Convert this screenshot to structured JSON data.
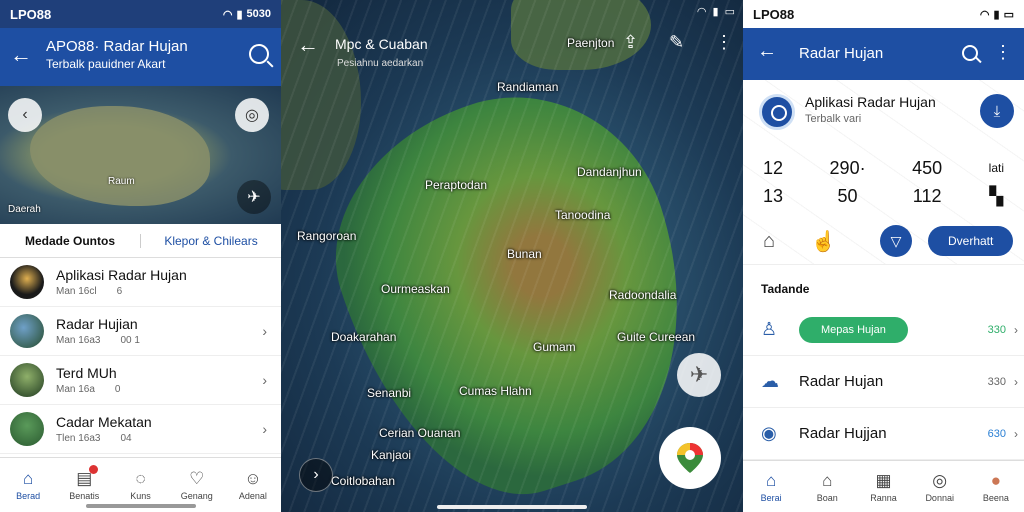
{
  "left": {
    "status_time": "LPO88",
    "status_battery": "5030",
    "title": "APO88· Radar Hujan",
    "subtitle": "Terbalk pauidner Akart",
    "map_labels": {
      "town": "Raum",
      "coast": "Daerah"
    },
    "tabs": [
      "Medade Ountos",
      "Klepor & Chilears"
    ],
    "rows": [
      {
        "name": "Aplikasi Radar Hujan",
        "meta1": "Man 16cl",
        "meta2": "6"
      },
      {
        "name": "Radar Hujian",
        "meta1": "Man 16a3",
        "meta2": "00 1"
      },
      {
        "name": "Terd MUh",
        "meta1": "Man 16a",
        "meta2": "0"
      },
      {
        "name": "Cadar Mekatan",
        "meta1": "Tlen 16a3",
        "meta2": "04"
      }
    ],
    "nav": [
      "Berad",
      "Benatis",
      "Kuns",
      "Genang",
      "Adenal"
    ]
  },
  "middle": {
    "title": "Mpc & Cuaban",
    "subtitle": "Pesiahnu aedarkan",
    "places": {
      "p1": "Paenjton",
      "p2": "Randiaman",
      "p3": "Peraptodan",
      "p4": "Dandanjhun",
      "p5": "Tanoodina",
      "p6": "Rangoroan",
      "p7": "Bunan",
      "p8": "Ourmeaskan",
      "p9": "Radoondalia",
      "p10": "Doakarahan",
      "p11": "Guite Cureean",
      "p12": "Gumam",
      "p13": "Senanbi",
      "p14": "Cumas Hlahn",
      "p15": "Cerian Ouanan",
      "p16": "Kanjaoi",
      "p17": "Coitlobahan"
    }
  },
  "right": {
    "status_time": "LPO88",
    "title": "Radar Hujan",
    "card_title": "Aplikasi Radar Hujan",
    "card_sub": "Terbalk vari",
    "stats": [
      {
        "top": "12",
        "bottom": "13"
      },
      {
        "top": "290·",
        "bottom": "50"
      },
      {
        "top": "450",
        "bottom": "112"
      },
      {
        "top": "lati",
        "bottom": ""
      }
    ],
    "action_button": "Dverhatt",
    "section": "Tadande",
    "rows": [
      {
        "label": "Mepas Hujan",
        "value": "330"
      },
      {
        "label": "Radar Hujan",
        "value": "330"
      },
      {
        "label": "Radar Hujjan",
        "value": "630"
      }
    ],
    "nav": [
      "Berai",
      "Boan",
      "Ranna",
      "Donnai",
      "Beena"
    ]
  },
  "colors": {
    "primary": "#1e4fa3",
    "accent_green": "#2fae6a"
  },
  "icons": [
    "back-arrow-icon",
    "search-icon",
    "more-icon",
    "home-icon",
    "location-pin-icon"
  ]
}
